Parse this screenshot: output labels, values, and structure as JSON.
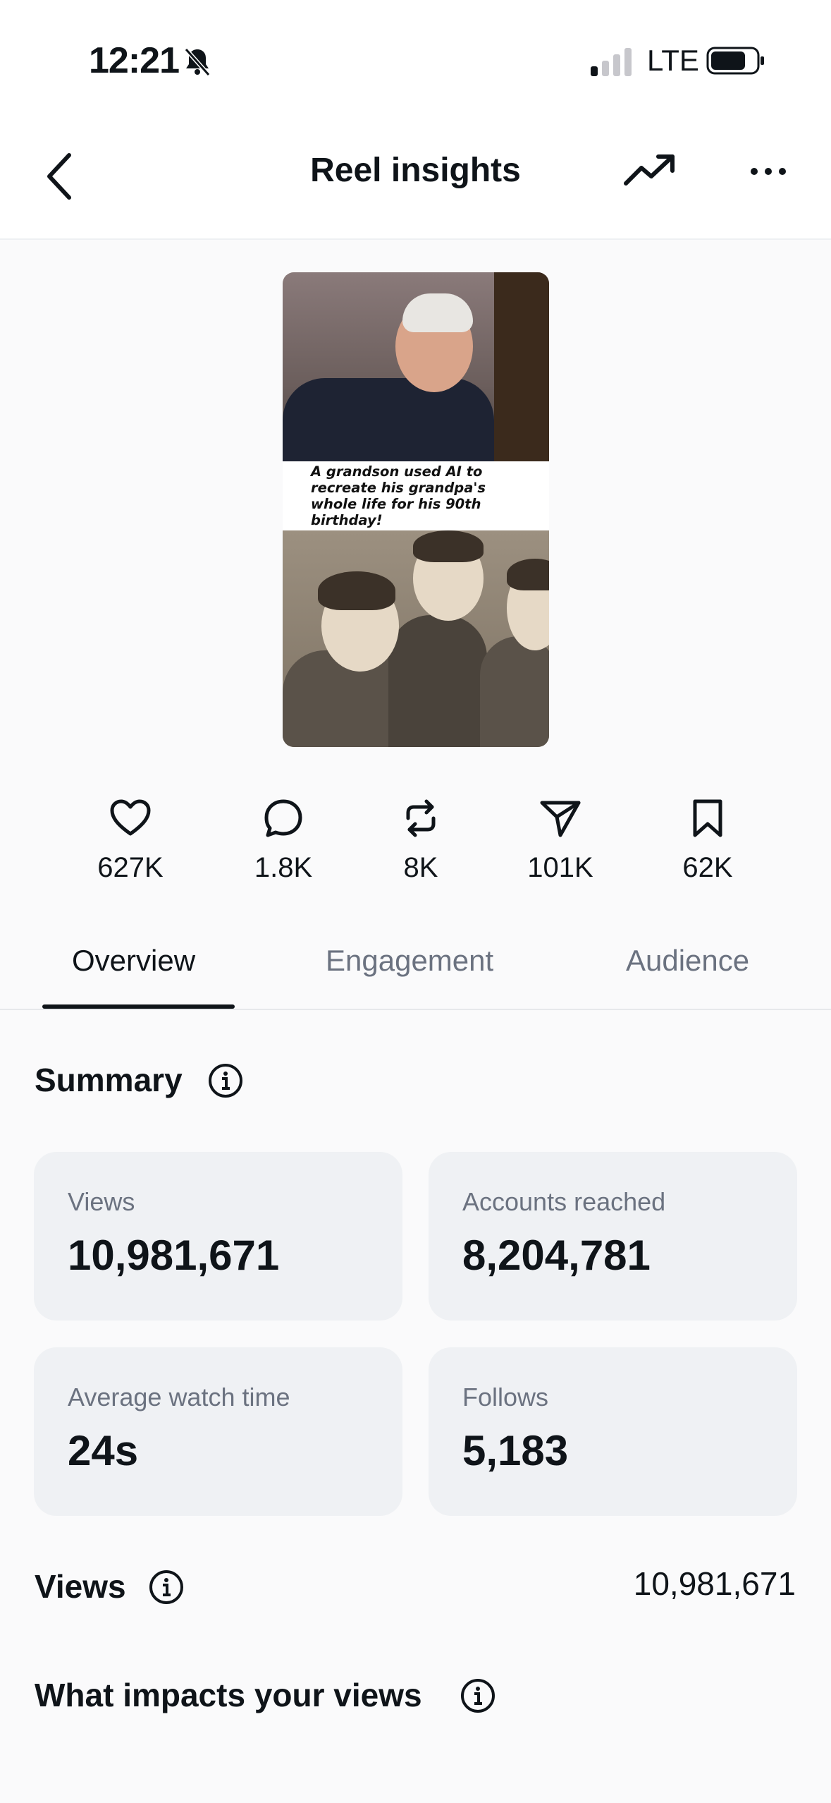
{
  "status_bar": {
    "time": "12:21",
    "network": "LTE"
  },
  "header": {
    "title": "Reel insights"
  },
  "reel": {
    "caption": "A grandson used AI to recreate his grandpa's whole life for his 90th birthday!"
  },
  "stats": {
    "likes": "627K",
    "comments": "1.8K",
    "reposts": "8K",
    "shares": "101K",
    "saves": "62K"
  },
  "tabs": [
    {
      "label": "Overview",
      "active": true
    },
    {
      "label": "Engagement",
      "active": false
    },
    {
      "label": "Audience",
      "active": false
    }
  ],
  "summary": {
    "title": "Summary",
    "cards": [
      {
        "label": "Views",
        "value": "10,981,671"
      },
      {
        "label": "Accounts reached",
        "value": "8,204,781"
      },
      {
        "label": "Average watch time",
        "value": "24s"
      },
      {
        "label": "Follows",
        "value": "5,183"
      }
    ]
  },
  "views_section": {
    "title": "Views",
    "value": "10,981,671"
  },
  "impacts_section": {
    "title": "What impacts your views"
  },
  "colors": {
    "text": "#0f1419",
    "muted": "#6b7280",
    "card_bg": "#eff1f4"
  }
}
